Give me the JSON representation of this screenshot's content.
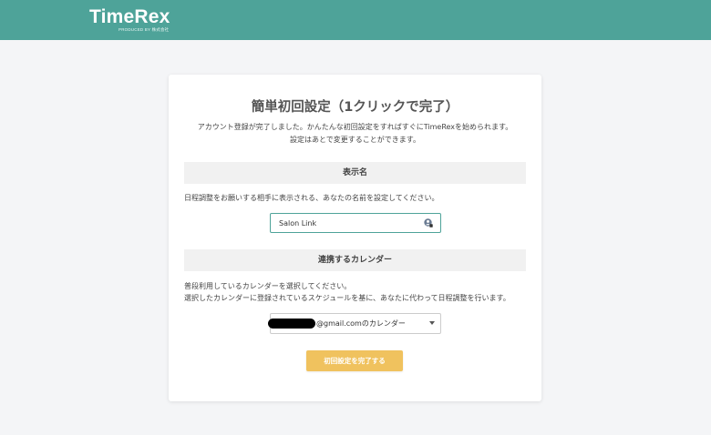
{
  "header": {
    "logo": "TimeRex",
    "logo_sub": "PRODUCED BY 株式会社",
    "bg_color": "#4ea399"
  },
  "setup": {
    "title": "簡単初回設定（1クリックで完了）",
    "intro_line1": "アカウント登録が完了しました。かんたんな初回設定をすればすぐにTimeRexを始められます。",
    "intro_line2": "設定はあとで変更することができます。"
  },
  "display_name": {
    "heading": "表示名",
    "description": "日程調整をお願いする相手に表示される、あなたの名前を設定してください。",
    "value": "Salon Link",
    "icon": "contact-autofill-icon"
  },
  "calendar": {
    "heading": "連携するカレンダー",
    "description_line1": "普段利用しているカレンダーを選択してください。",
    "description_line2": "選択したカレンダーに登録されているスケジュールを基に、あなたに代わって日程調整を行います。",
    "selected": "@gmail.comのカレンダー"
  },
  "submit": {
    "label": "初回設定を完了する",
    "color": "#f0c25e"
  }
}
